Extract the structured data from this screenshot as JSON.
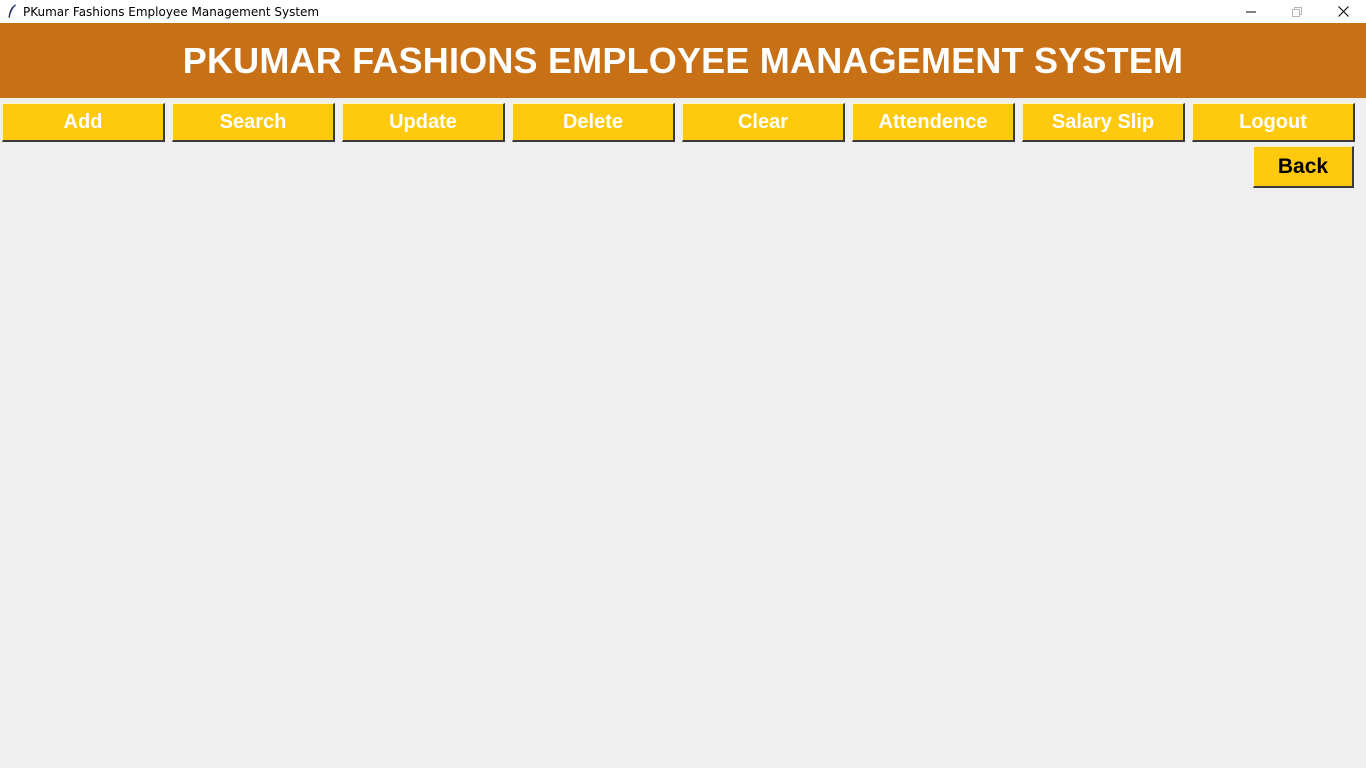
{
  "window": {
    "title": "PKumar Fashions Employee Management System",
    "icon": "feather-icon",
    "controls": [
      "minimize-icon",
      "restore-icon",
      "close-icon"
    ]
  },
  "header": {
    "title": "PKUMAR FASHIONS EMPLOYEE MANAGEMENT SYSTEM",
    "background": "#c87016"
  },
  "toolbar": {
    "buttons": [
      "Add",
      "Search",
      "Update",
      "Delete",
      "Clear",
      "Attendence",
      "Salary Slip",
      "Logout"
    ],
    "button_color": "#ffc90e"
  },
  "back_button": {
    "label": "Back"
  }
}
